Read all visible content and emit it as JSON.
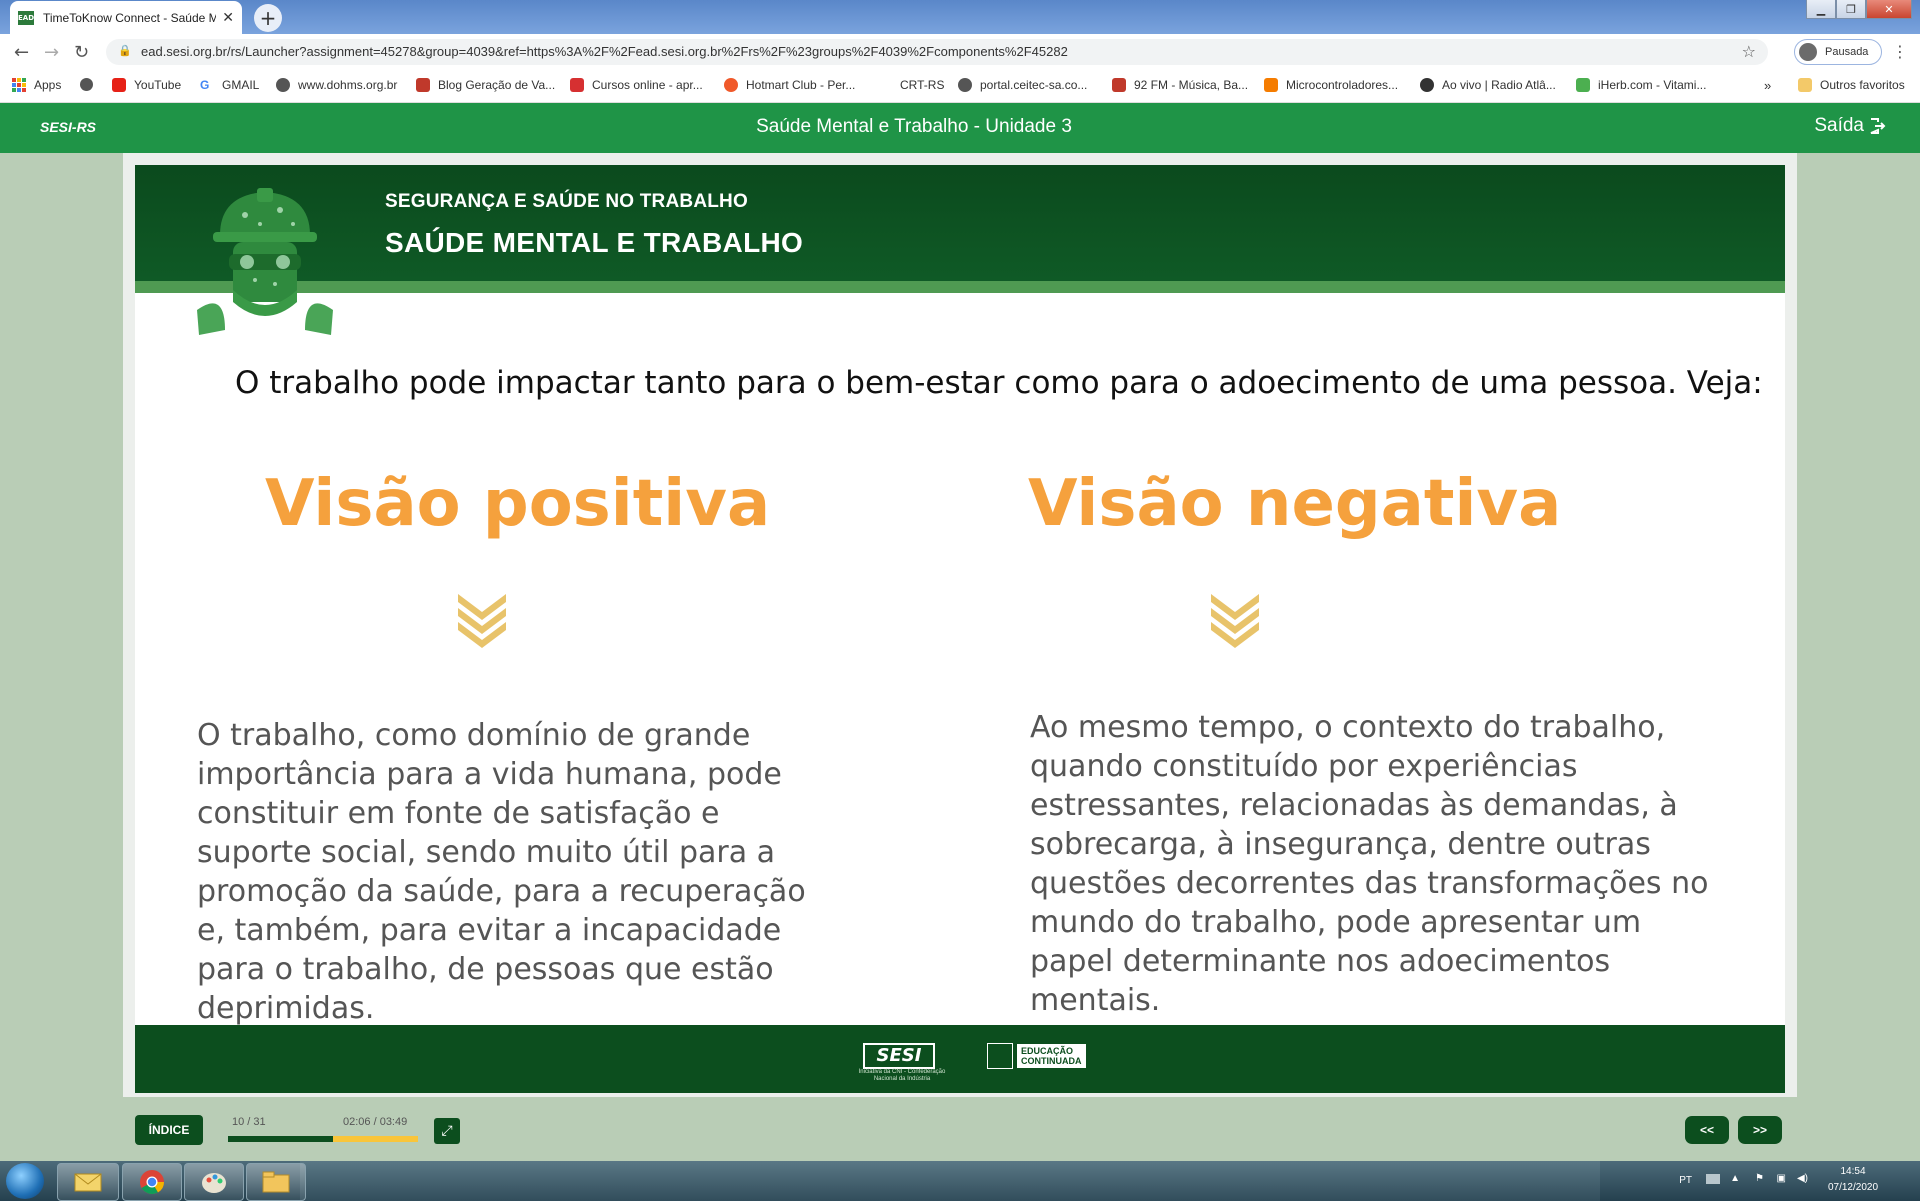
{
  "browser": {
    "tab_title": "TimeToKnow Connect - Saúde M",
    "tab_favicon_text": "EAD",
    "url": "ead.sesi.org.br/rs/Launcher?assignment=45278&group=4039&ref=https%3A%2F%2Fead.sesi.org.br%2Frs%2F%23groups%2F4039%2Fcomponents%2F45282",
    "profile_label": "Pausada",
    "bookmarks": [
      {
        "label": "Apps",
        "color": "#e34133"
      },
      {
        "label": "YouTube",
        "color": "#e62117"
      },
      {
        "label": "GMAIL",
        "color": "#4285f4"
      },
      {
        "label": "www.dohms.org.br",
        "color": "#555555"
      },
      {
        "label": "Blog Geração de Va...",
        "color": "#c0392b"
      },
      {
        "label": "Cursos online - apr...",
        "color": "#d63031"
      },
      {
        "label": "Hotmart Club - Per...",
        "color": "#f0592a"
      },
      {
        "label": "CRT-RS",
        "color": "#ffffff"
      },
      {
        "label": "portal.ceitec-sa.co...",
        "color": "#555555"
      },
      {
        "label": "92 FM - Música, Ba...",
        "color": "#c0392b"
      },
      {
        "label": "Microcontroladores...",
        "color": "#f57c00"
      },
      {
        "label": "Ao vivo | Radio Atlâ...",
        "color": "#333333"
      },
      {
        "label": "iHerb.com - Vitami...",
        "color": "#4caf50"
      }
    ],
    "other_bookmarks": "Outros favoritos"
  },
  "app": {
    "logo": "SESI-RS",
    "title": "Saúde Mental e Trabalho - Unidade 3",
    "exit_label": "Saída"
  },
  "slide": {
    "banner_subtitle": "SEGURANÇA E SAÚDE NO TRABALHO",
    "banner_title": "SAÚDE MENTAL E TRABALHO",
    "intro": "O trabalho pode  impactar tanto para o bem-estar como para o adoecimento de uma pessoa. Veja:",
    "left": {
      "title": "Visão positiva",
      "text": "O trabalho, como domínio de grande importância para a vida humana, pode constituir em fonte de satisfação e suporte social, sendo muito útil para a promoção da saúde, para a recuperação e, também, para evitar a incapacidade para o trabalho, de pessoas que estão deprimidas."
    },
    "right": {
      "title": "Visão negativa",
      "text": "Ao mesmo tempo, o contexto do trabalho, quando constituído por experiências estressantes, relacionadas às demandas, à sobrecarga, à insegurança, dentre outras questões decorrentes das transformações no mundo do trabalho, pode apresentar um papel determinante nos adoecimentos mentais."
    },
    "footer": {
      "sesi": "SESI",
      "sesi_tagline": "Iniciativa da CNI - Confederação Nacional da Indústria",
      "educacao": "EDUCAÇÃO",
      "continuada": "CONTINUADA"
    }
  },
  "player": {
    "index_label": "ÍNDICE",
    "slide_counter": "10 / 31",
    "time_counter": "02:06 / 03:49",
    "progress_fraction": 0.55,
    "prev_label": "<<",
    "next_label": ">>"
  },
  "taskbar": {
    "lang": "PT",
    "time": "14:54",
    "date": "07/12/2020"
  },
  "colors": {
    "accent_orange": "#f5a13d",
    "chevron": "#e8c36a",
    "dark_green": "#0c4e1e",
    "header_green": "#1f9447"
  }
}
